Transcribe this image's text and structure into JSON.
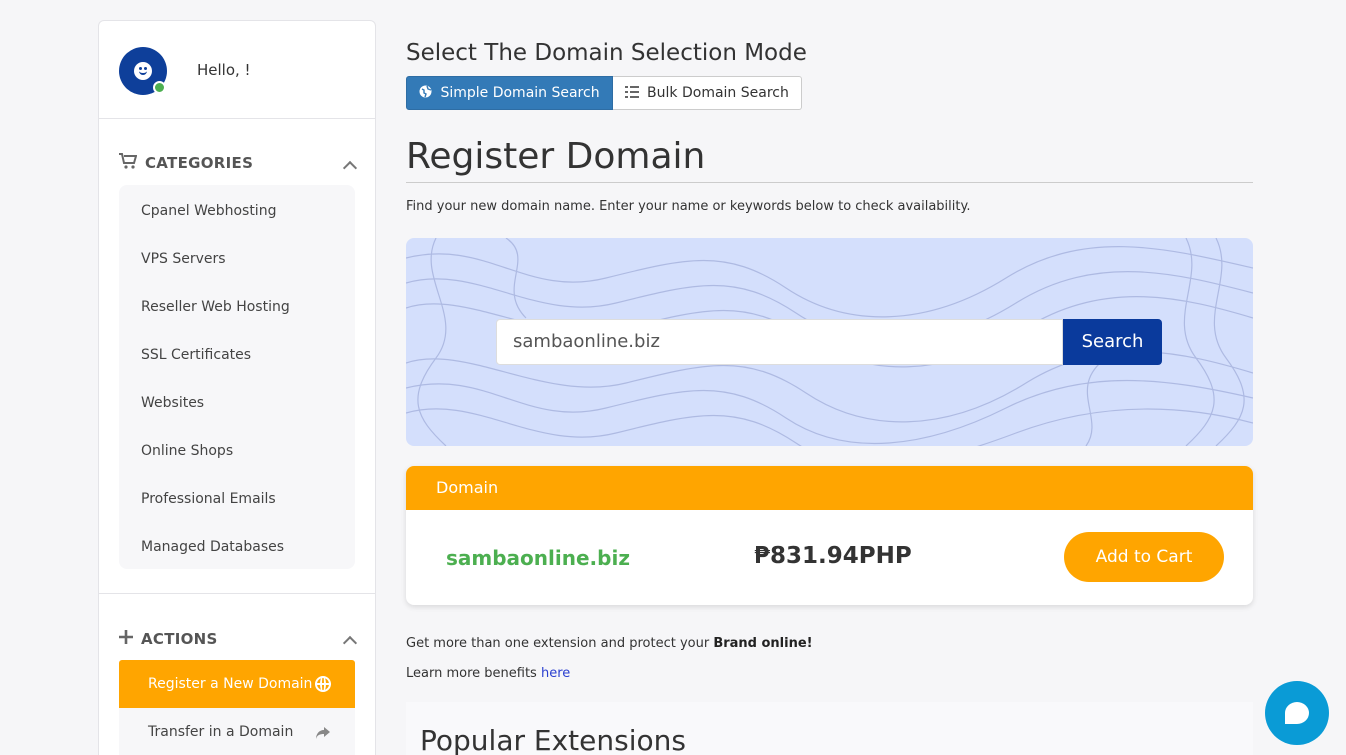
{
  "user": {
    "greeting": "Hello, !"
  },
  "sidebar": {
    "categories_title": "CATEGORIES",
    "categories": [
      "Cpanel Webhosting",
      "VPS Servers",
      "Reseller Web Hosting",
      "SSL Certificates",
      "Websites",
      "Online Shops",
      "Professional Emails",
      "Managed Databases"
    ],
    "actions_title": "ACTIONS",
    "actions": [
      {
        "label": "Register a New Domain",
        "active": true,
        "icon": "globe-icon"
      },
      {
        "label": "Transfer in a Domain",
        "active": false,
        "icon": "share-arrow-icon"
      }
    ]
  },
  "mode": {
    "title": "Select The Domain Selection Mode",
    "tabs": [
      {
        "label": "Simple Domain Search",
        "icon": "globe-icon",
        "active": true
      },
      {
        "label": "Bulk Domain Search",
        "icon": "list-icon",
        "active": false
      }
    ]
  },
  "register": {
    "title": "Register Domain",
    "intro": "Find your new domain name. Enter your name or keywords below to check availability."
  },
  "search": {
    "value": "sambaonline.biz",
    "button_label": "Search"
  },
  "result": {
    "header": "Domain",
    "domain": "sambaonline.biz",
    "price": "₱831.94PHP",
    "cta": "Add to Cart"
  },
  "promo": {
    "text": "Get more than one extension and protect your ",
    "bold": "Brand online!",
    "learn_text": "Learn more benefits ",
    "learn_link": "here"
  },
  "popular": {
    "title": "Popular Extensions"
  },
  "colors": {
    "accent": "#ffa500",
    "primary": "#0a3a9c",
    "tab_active": "#337ab7",
    "domain_green": "#4caf50",
    "chat": "#0a9bd6"
  }
}
